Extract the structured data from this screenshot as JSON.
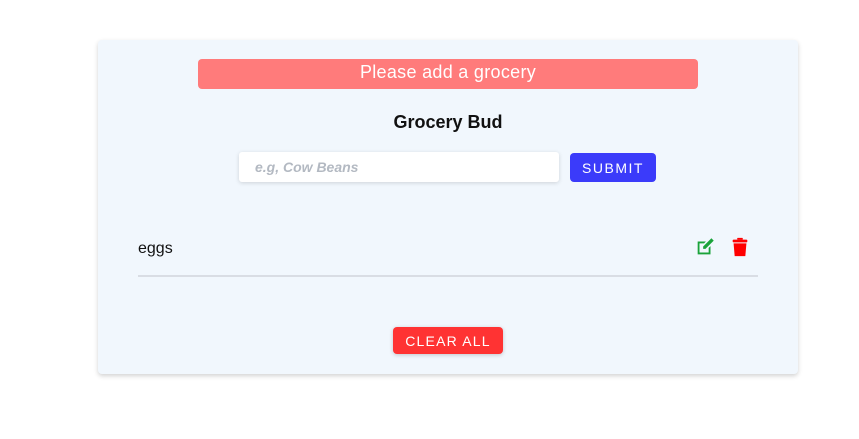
{
  "alert": {
    "text": "Please add a grocery",
    "color": "#ff7b7b"
  },
  "app": {
    "title": "Grocery Bud"
  },
  "form": {
    "placeholder": "e.g, Cow Beans",
    "value": "",
    "submit_label": "SUBMIT",
    "submit_color": "#3b3bfa"
  },
  "list": {
    "items": [
      {
        "label": "eggs",
        "edit_icon": "edit-icon",
        "delete_icon": "trash-icon"
      }
    ],
    "edit_color": "#1aa33a",
    "delete_color": "#ff0000"
  },
  "footer": {
    "clear_label": "CLEAR ALL",
    "clear_color": "#ff3333"
  }
}
